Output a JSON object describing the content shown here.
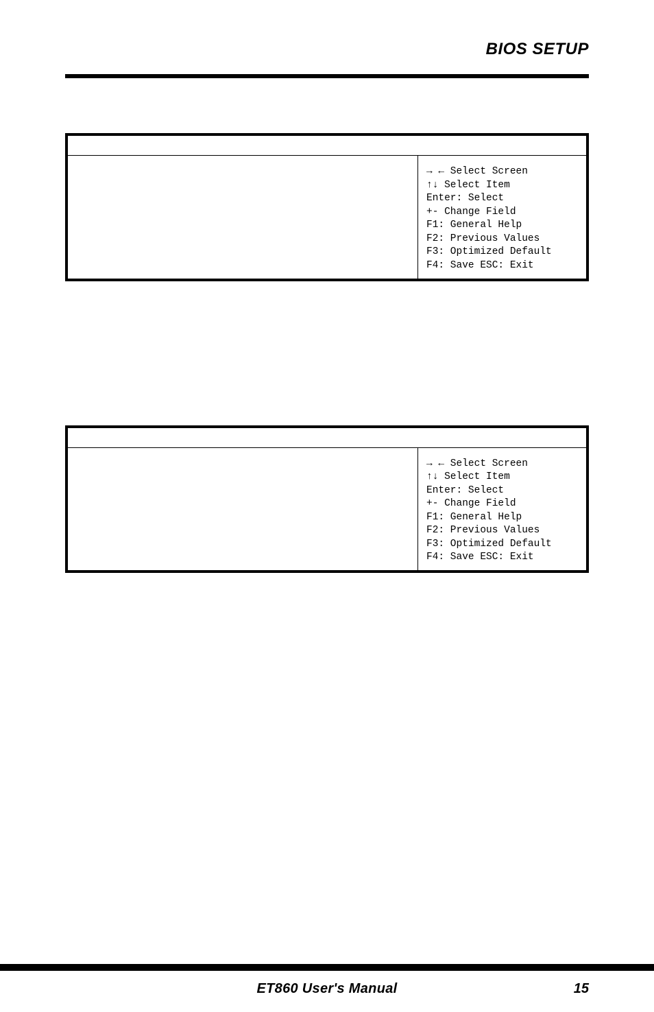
{
  "header": {
    "title": "BIOS SETUP"
  },
  "bios_help": {
    "select_screen": "→ ← Select Screen",
    "select_item": "↑↓  Select Item",
    "enter_select": "Enter: Select",
    "change_field": "+-  Change Field",
    "general_help": "F1: General Help",
    "previous_values": "F2: Previous Values",
    "optimized_default": "F3: Optimized Default",
    "save_exit": "F4: Save  ESC: Exit"
  },
  "footer": {
    "manual": "ET860 User's Manual",
    "page": "15"
  }
}
